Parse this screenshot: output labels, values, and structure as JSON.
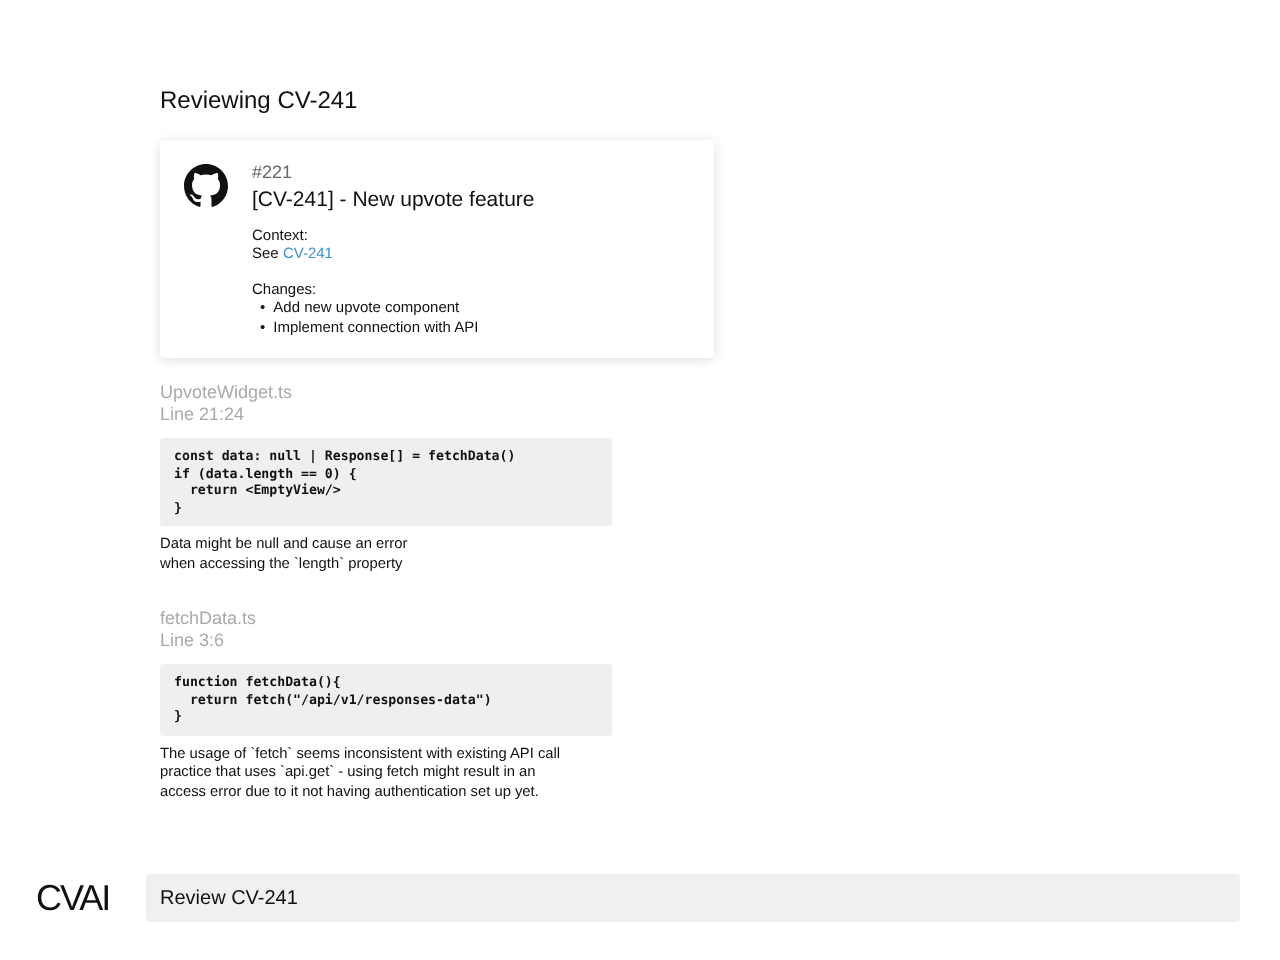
{
  "heading": "Reviewing CV-241",
  "pull_request": {
    "number": "#221",
    "title": "[CV-241] - New upvote feature",
    "context_label": "Context:",
    "context_prefix": "See",
    "context_link": "CV-241",
    "changes_label": "Changes:",
    "bullet": "•",
    "changes": [
      "Add new upvote component",
      "Implement connection with API"
    ]
  },
  "comments": [
    {
      "file": "UpvoteWidget.ts",
      "lines": "Line 21:24",
      "code": [
        "const data: null | Response[] = fetchData()",
        "if (data.length == 0) {",
        "  return <EmptyView/>",
        "}"
      ],
      "text": [
        "Data might be null and cause an error",
        "when accessing the `length` property"
      ]
    },
    {
      "file": "fetchData.ts",
      "lines": "Line 3:6",
      "code": [
        "function fetchData(){",
        "  return fetch(\"/api/v1/responses-data\")",
        "}"
      ],
      "text": [
        "The usage of `fetch` seems inconsistent with existing API call",
        "practice that uses `api.get` - using fetch might result in an",
        "access error due to it not having authentication set up yet."
      ]
    }
  ],
  "footer": {
    "logo": "CVAI",
    "input_value": "Review CV-241"
  }
}
